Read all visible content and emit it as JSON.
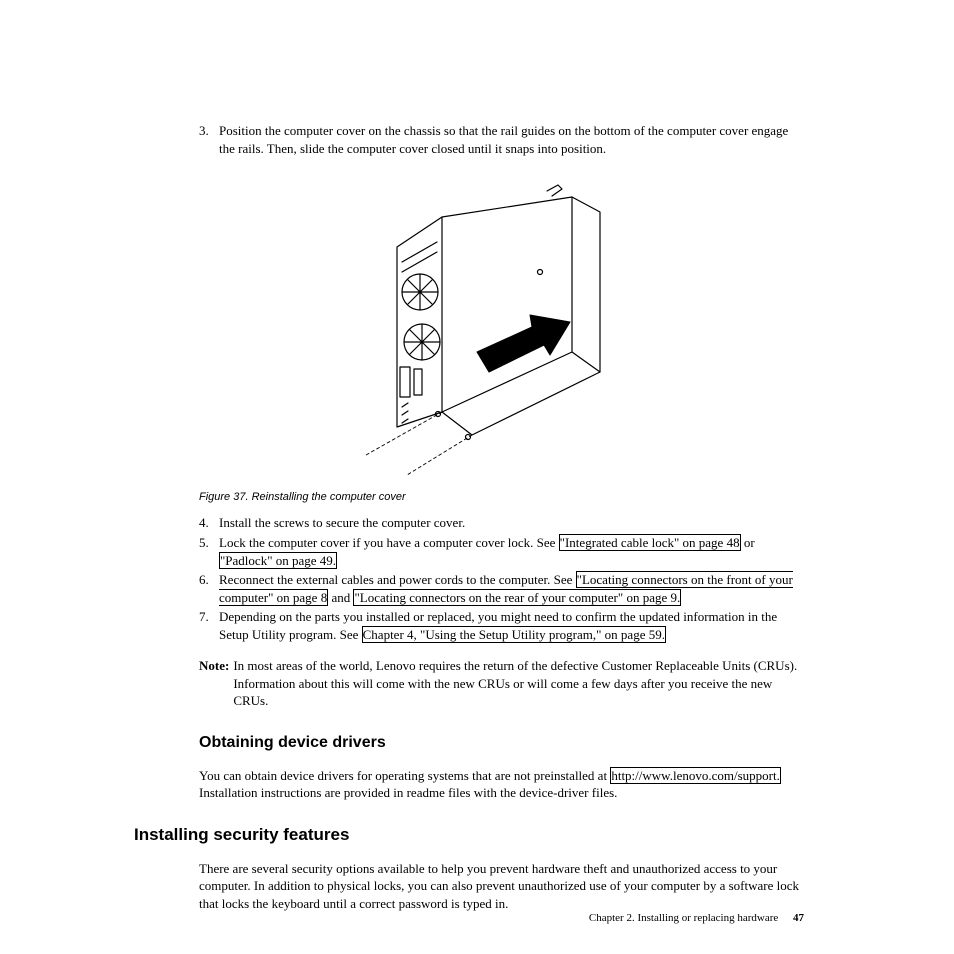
{
  "steps_top": {
    "num": "3.",
    "text": "Position the computer cover on the chassis so that the rail guides on the bottom of the computer cover engage the rails. Then, slide the computer cover closed until it snaps into position."
  },
  "figure_caption": "Figure 37. Reinstalling the computer cover",
  "steps_bottom": [
    {
      "num": "4.",
      "parts": [
        {
          "t": "text",
          "v": "Install the screws to secure the computer cover."
        }
      ]
    },
    {
      "num": "5.",
      "parts": [
        {
          "t": "text",
          "v": "Lock the computer cover if you have a computer cover lock. See "
        },
        {
          "t": "link",
          "v": "\"Integrated cable lock\" on page 48"
        },
        {
          "t": "text",
          "v": " or "
        },
        {
          "t": "link",
          "v": "\"Padlock\" on page 49."
        }
      ]
    },
    {
      "num": "6.",
      "parts": [
        {
          "t": "text",
          "v": "Reconnect the external cables and power cords to the computer. See "
        },
        {
          "t": "link",
          "v": "\"Locating connectors on the front of your computer\" on page 8"
        },
        {
          "t": "text",
          "v": " and "
        },
        {
          "t": "link",
          "v": "\"Locating connectors on the rear of your computer\" on page 9."
        }
      ]
    },
    {
      "num": "7.",
      "parts": [
        {
          "t": "text",
          "v": "Depending on the parts you installed or replaced, you might need to confirm the updated information in the Setup Utility program. See "
        },
        {
          "t": "link",
          "v": "Chapter 4, \"Using the Setup Utility program,\" on page 59."
        }
      ]
    }
  ],
  "note": {
    "label": "Note:",
    "text": "In most areas of the world, Lenovo requires the return of the defective Customer Replaceable Units (CRUs). Information about this will come with the new CRUs or will come a few days after you receive the new CRUs."
  },
  "section1": {
    "heading": "Obtaining device drivers",
    "text_pre": "You can obtain device drivers for operating systems that are not preinstalled at ",
    "link": "http://www.lenovo.com/support.",
    "text_post": " Installation instructions are provided in readme files with the device-driver files."
  },
  "section2": {
    "heading": "Installing security features",
    "text": "There are several security options available to help you prevent hardware theft and unauthorized access to your computer. In addition to physical locks, you can also prevent unauthorized use of your computer by a software lock that locks the keyboard until a correct password is typed in."
  },
  "footer": {
    "chapter": "Chapter 2. Installing or replacing hardware",
    "page": "47"
  }
}
